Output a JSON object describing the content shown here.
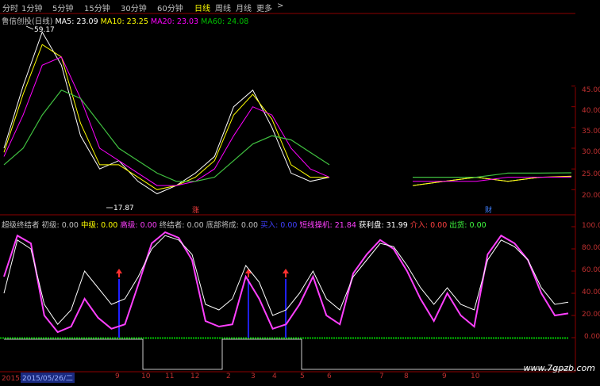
{
  "toolbar": {
    "tabs": [
      "分时",
      "1分钟",
      "5分钟",
      "15分钟",
      "30分钟",
      "60分钟",
      "日线",
      "周线",
      "月线",
      "更多"
    ],
    "active": "日线",
    "more_icon": "chevron-right-icon"
  },
  "main_legend": {
    "title": "鲁信创投(日线)",
    "ma5": "MA5: 23.09",
    "ma10": "MA10: 23.25",
    "ma20": "MA20: 23.03",
    "ma60": "MA60: 24.08",
    "colors": {
      "ma5": "#ffffff",
      "ma10": "#ffff00",
      "ma20": "#ff00ff",
      "ma60": "#00c000"
    }
  },
  "price_annotations": {
    "high": "59.17",
    "low": "17.87"
  },
  "price_axis": [
    "45.00",
    "40.00",
    "35.00",
    "30.00",
    "25.00",
    "20.00"
  ],
  "markers": {
    "zhang": "涨",
    "cai": "财"
  },
  "indicator_legend": {
    "name": "超级终结者",
    "chuji": "初级: 0.00",
    "zhongji": "中级: 0.00",
    "gaoji": "高级: 0.00",
    "zhongjiezhe": "终结者: 0.00",
    "dibu": "底部将成: 0.00",
    "tianzi": "买入: 0.00",
    "duanxian": "短线操机: 21.84",
    "huoli": "获利盘: 31.99",
    "jieru": "介入: 0.00",
    "chuhuo": "出货: 0.00"
  },
  "indicator_axis": [
    "100.00",
    "80.00",
    "60.00",
    "40.00",
    "20.00",
    "0.00"
  ],
  "x_axis": {
    "date": "2015/05/26/二",
    "year": "2015年",
    "months": [
      "9",
      "10",
      "11",
      "12",
      "2",
      "3",
      "4",
      "5",
      "6",
      "7",
      "8",
      "9",
      "10"
    ]
  },
  "watermark": "www.7gpzb.com",
  "chart_data": [
    {
      "type": "line",
      "title": "鲁信创投(日线)",
      "series": [
        {
          "name": "MA5",
          "values": [
            30,
            45,
            58,
            50,
            33,
            25,
            27,
            22,
            19,
            21,
            24,
            28,
            40,
            44,
            35,
            24,
            22,
            23,
            22,
            21,
            22,
            23,
            22,
            23,
            23.09
          ]
        },
        {
          "name": "MA10",
          "values": [
            29,
            43,
            55,
            52,
            36,
            26,
            26,
            23,
            20,
            21,
            23,
            27,
            38,
            43,
            37,
            26,
            23,
            23,
            22,
            21,
            22,
            23,
            22,
            23,
            23.25
          ]
        },
        {
          "name": "MA20",
          "values": [
            28,
            38,
            50,
            52,
            42,
            30,
            27,
            24,
            21,
            21,
            22,
            25,
            33,
            40,
            38,
            30,
            25,
            23,
            22,
            22,
            22,
            22,
            23,
            23,
            23.03
          ]
        },
        {
          "name": "MA60",
          "values": [
            26,
            30,
            38,
            44,
            42,
            36,
            30,
            27,
            24,
            22,
            22,
            23,
            27,
            31,
            33,
            32,
            29,
            26,
            24,
            23,
            23,
            23,
            24,
            24,
            24.08
          ]
        }
      ],
      "ylim": [
        17,
        60
      ]
    },
    {
      "type": "line",
      "title": "超级终结者",
      "series": [
        {
          "name": "短线操机",
          "values": [
            55,
            92,
            85,
            20,
            5,
            10,
            35,
            18,
            8,
            12,
            48,
            85,
            95,
            90,
            70,
            15,
            10,
            12,
            55,
            35,
            8,
            12,
            30,
            55,
            20,
            12,
            58,
            75,
            88,
            80,
            60,
            35,
            15,
            40,
            20,
            10,
            75,
            92,
            85,
            70,
            40,
            20,
            21.84
          ]
        },
        {
          "name": "获利盘",
          "values": [
            40,
            88,
            80,
            30,
            12,
            25,
            60,
            45,
            30,
            35,
            55,
            80,
            92,
            88,
            75,
            30,
            25,
            35,
            65,
            50,
            20,
            25,
            40,
            60,
            35,
            25,
            55,
            70,
            85,
            82,
            65,
            45,
            30,
            45,
            30,
            25,
            70,
            88,
            82,
            70,
            45,
            30,
            31.99
          ]
        }
      ],
      "ylim": [
        0,
        100
      ]
    }
  ]
}
